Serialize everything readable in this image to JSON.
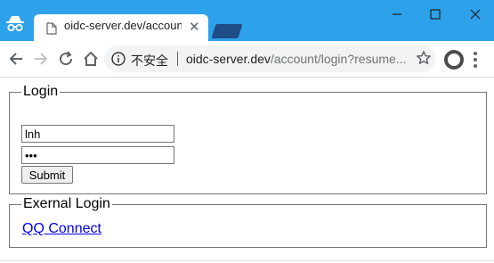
{
  "browser": {
    "tab_title": "oidc-server.dev/account/",
    "security_label": "不安全",
    "url_host": "oidc-server.dev",
    "url_path": "/account/login?resume...",
    "colors": {
      "titlebar": "#2da1e9",
      "new_tab": "#1f4d86"
    }
  },
  "page": {
    "login_legend": "Login",
    "username_value": "lnh",
    "password_value": "•••",
    "submit_label": "Submit",
    "external_legend": "Exernal Login",
    "qq_link": "QQ Connect"
  }
}
